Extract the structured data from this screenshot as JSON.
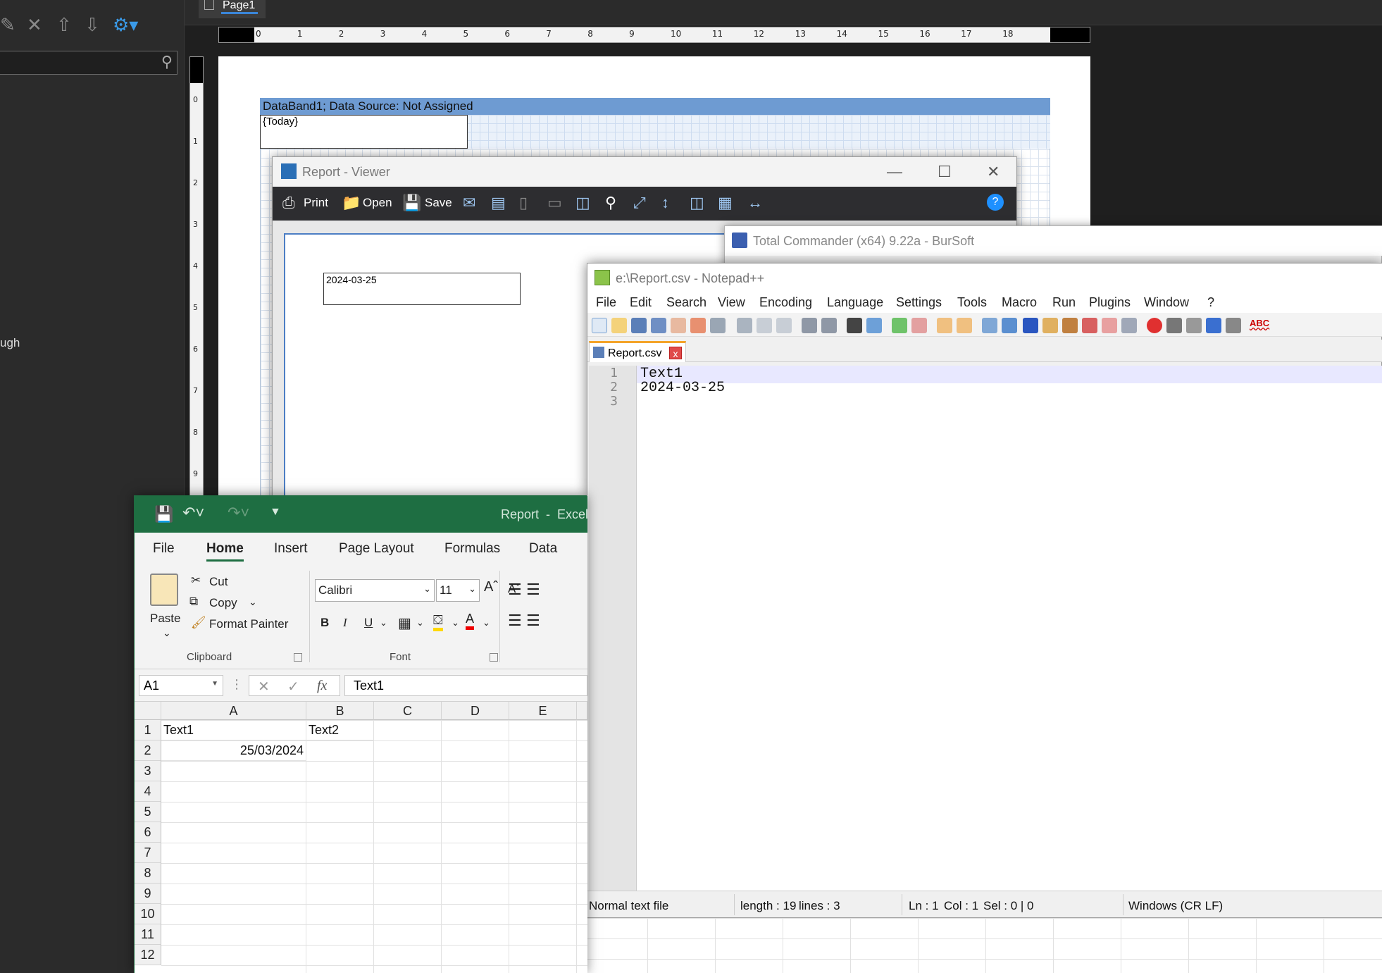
{
  "designer": {
    "page_tab": "Page1",
    "side_text": "ugh",
    "hruler_ticks": [
      "0",
      "1",
      "2",
      "3",
      "4",
      "5",
      "6",
      "7",
      "8",
      "9",
      "10",
      "11",
      "12",
      "13",
      "14",
      "15",
      "16",
      "17",
      "18"
    ],
    "vruler_ticks": [
      "0",
      "1",
      "2",
      "3",
      "4",
      "5",
      "6",
      "7",
      "8",
      "9"
    ],
    "databand_label": "DataBand1; Data Source: Not Assigned",
    "today_field": "{Today}"
  },
  "viewer": {
    "title": "Report - Viewer",
    "toolbar": {
      "print": "Print",
      "open": "Open",
      "save": "Save"
    },
    "date_value": "2024-03-25"
  },
  "total_commander": {
    "title": "Total Commander (x64) 9.22a - BurSoft"
  },
  "notepad": {
    "title": "e:\\Report.csv - Notepad++",
    "menu": [
      "File",
      "Edit",
      "Search",
      "View",
      "Encoding",
      "Language",
      "Settings",
      "Tools",
      "Macro",
      "Run",
      "Plugins",
      "Window",
      "?"
    ],
    "tab_name": "Report.csv",
    "tab_close": "x",
    "line_numbers": [
      "1",
      "2",
      "3"
    ],
    "lines": [
      "Text1",
      "2024-03-25",
      ""
    ],
    "status": {
      "type": "Normal text file",
      "length": "length : 19",
      "lines": "lines : 3",
      "ln": "Ln : 1",
      "col": "Col : 1",
      "sel": "Sel : 0 | 0",
      "eol": "Windows (CR LF)"
    }
  },
  "excel": {
    "title": "Report  -  Excel",
    "tabs": [
      "File",
      "Home",
      "Insert",
      "Page Layout",
      "Formulas",
      "Data"
    ],
    "active_tab": "Home",
    "clipboard": {
      "paste": "Paste",
      "cut": "Cut",
      "copy": "Copy",
      "format_painter": "Format Painter",
      "group": "Clipboard"
    },
    "font": {
      "name": "Calibri",
      "size": "11",
      "group": "Font",
      "bold": "B",
      "italic": "I",
      "underline": "U"
    },
    "name_box": "A1",
    "formula_value": "Text1",
    "fx": "fx",
    "columns": [
      "A",
      "B",
      "C",
      "D",
      "E"
    ],
    "rows": [
      "1",
      "2",
      "3",
      "4",
      "5",
      "6",
      "7",
      "8",
      "9",
      "10",
      "11",
      "12"
    ],
    "cells": {
      "A1": "Text1",
      "B1": "Text2",
      "A2": "25/03/2024"
    }
  }
}
